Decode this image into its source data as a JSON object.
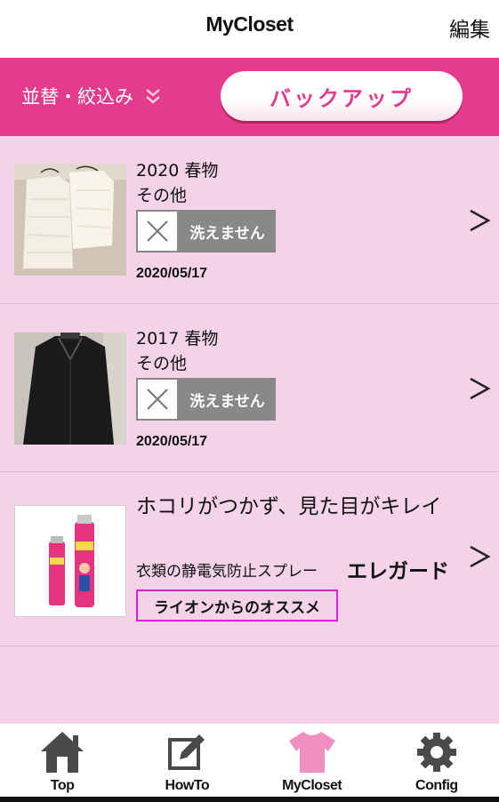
{
  "header": {
    "title": "MyCloset",
    "edit_label": "編集"
  },
  "toolbar": {
    "sort_label": "並替・絞込み",
    "backup_label": "バックアップ"
  },
  "items": [
    {
      "line1": "2020 春物",
      "line2": "その他",
      "wash_label": "洗えません",
      "date": "2020/05/17"
    },
    {
      "line1": "2017 春物",
      "line2": "その他",
      "wash_label": "洗えません",
      "date": "2020/05/17"
    }
  ],
  "ad": {
    "headline": "ホコリがつかず、見た目がキレイ",
    "subtext": "衣類の静電気防止スプレー",
    "product": "エレガード",
    "promo": "ライオンからのオススメ"
  },
  "tabs": [
    {
      "label": "Top",
      "icon": "house-icon"
    },
    {
      "label": "HowTo",
      "icon": "edit-icon"
    },
    {
      "label": "MyCloset",
      "icon": "tshirt-icon",
      "active": true
    },
    {
      "label": "Config",
      "icon": "gear-icon"
    }
  ],
  "colors": {
    "accent": "#e43c8d",
    "list_bg": "#f4d3e8",
    "active_tab": "#f08fc0",
    "inactive_icon": "#4a4a4a",
    "promo_border": "#e020d8"
  }
}
